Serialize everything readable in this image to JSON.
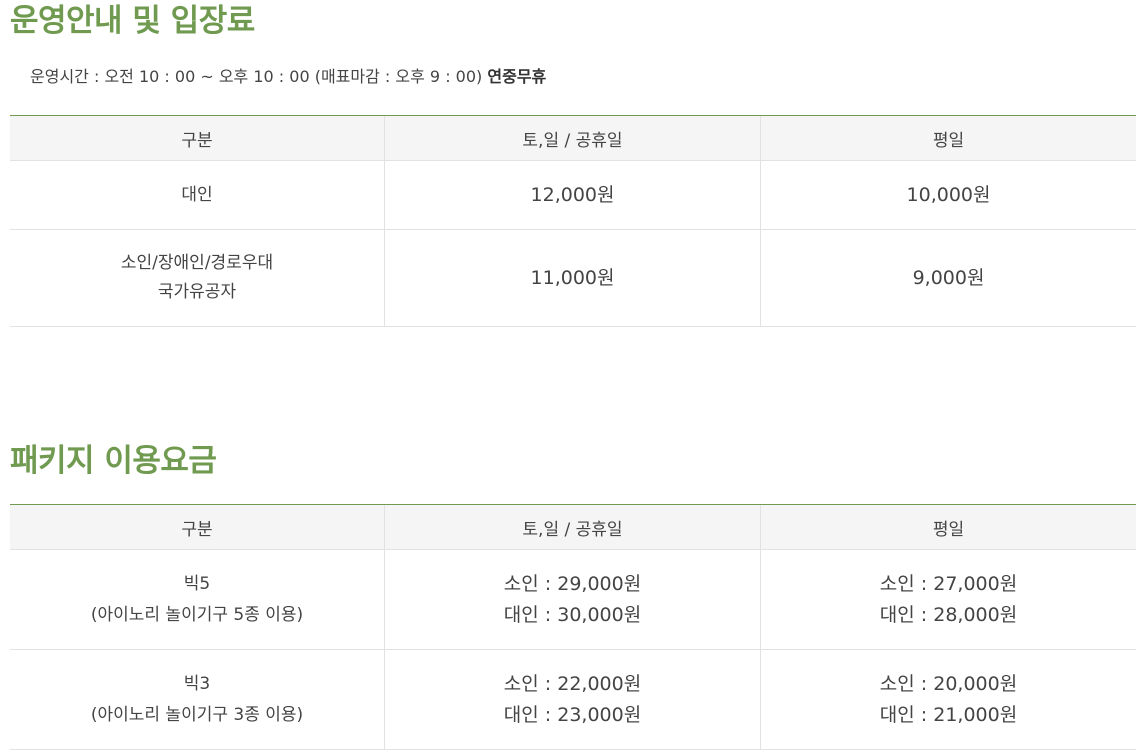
{
  "operation": {
    "title": "운영안내 및 입장료",
    "hours_text": "운영시간 : 오전 10 : 00 ~ 오후 10 : 00 (매표마감 : 오후 9 : 00)",
    "closed_text": "연중무휴",
    "headers": [
      "구분",
      "토,일 / 공휴일",
      "평일"
    ],
    "rows": [
      {
        "category_lines": [
          "대인"
        ],
        "weekend": "12,000원",
        "weekday": "10,000원"
      },
      {
        "category_lines": [
          "소인/장애인/경로우대",
          "국가유공자"
        ],
        "weekend": "11,000원",
        "weekday": "9,000원"
      }
    ]
  },
  "package": {
    "title": "패키지 이용요금",
    "headers": [
      "구분",
      "토,일 / 공휴일",
      "평일"
    ],
    "rows": [
      {
        "category_lines": [
          "빅5",
          "(아이노리 놀이기구 5종 이용)"
        ],
        "weekend": [
          "소인 : 29,000원",
          "대인 : 30,000원"
        ],
        "weekday": [
          "소인 : 27,000원",
          "대인 : 28,000원"
        ]
      },
      {
        "category_lines": [
          "빅3",
          "(아이노리 놀이기구 3종 이용)"
        ],
        "weekend": [
          "소인 : 22,000원",
          "대인 : 23,000원"
        ],
        "weekday": [
          "소인 : 20,000원",
          "대인 : 21,000원"
        ]
      }
    ]
  },
  "colors": {
    "accent_green": "#6f9a4f",
    "price_green": "#2f6a1a",
    "header_bg": "#f5f5f5",
    "border": "#e2e2e2"
  }
}
